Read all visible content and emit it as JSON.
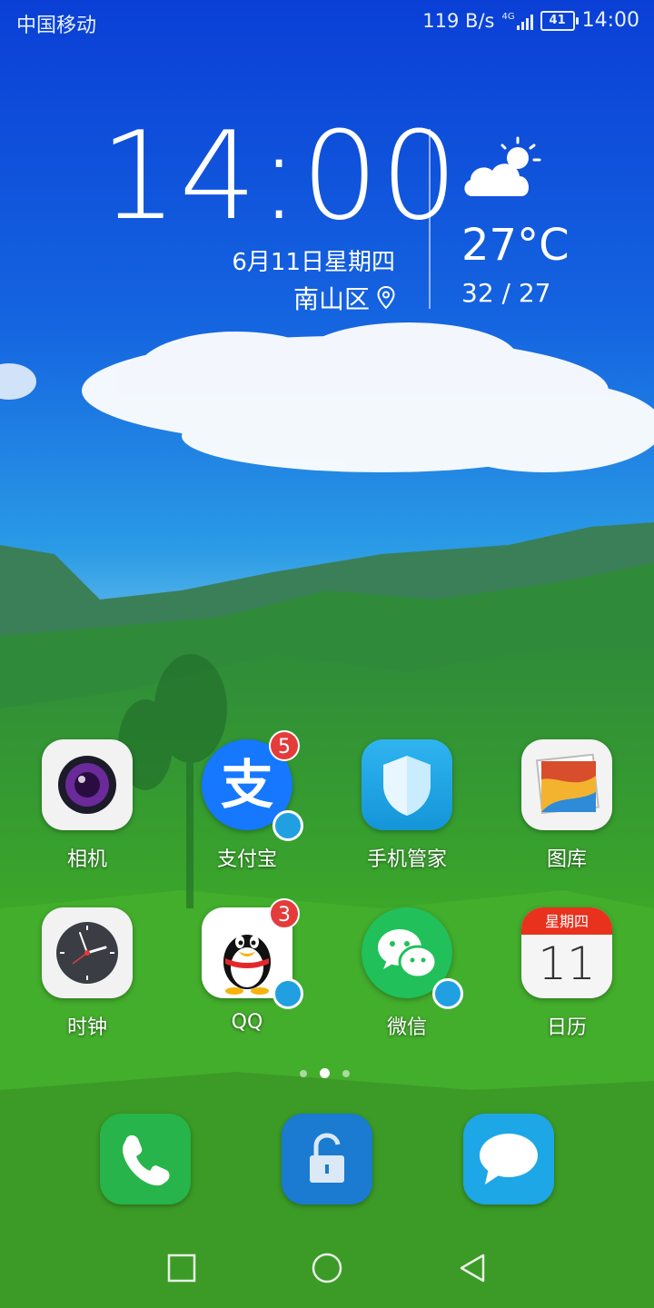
{
  "status_bar": {
    "carrier": "中国移动",
    "net_speed": "119 B/s",
    "network_type": "4G",
    "battery": "41",
    "time": "14:00"
  },
  "clock_widget": {
    "time": "14:00",
    "date": "6月11日星期四",
    "location": "南山区",
    "weather_icon": "partly-cloudy-icon",
    "temperature": "27°C",
    "range": "32 / 27"
  },
  "apps": [
    {
      "label": "相机",
      "icon": "camera-icon"
    },
    {
      "label": "支付宝",
      "icon": "alipay-icon",
      "badge": "5"
    },
    {
      "label": "手机管家",
      "icon": "phone-manager-icon"
    },
    {
      "label": "图库",
      "icon": "gallery-icon"
    },
    {
      "label": "时钟",
      "icon": "clock-icon"
    },
    {
      "label": "QQ",
      "icon": "qq-icon",
      "badge": "3"
    },
    {
      "label": "微信",
      "icon": "wechat-icon"
    },
    {
      "label": "日历",
      "icon": "calendar-icon",
      "calendar_header": "星期四",
      "calendar_day": "11"
    }
  ],
  "dock": [
    {
      "icon": "phone-icon"
    },
    {
      "icon": "lock-icon"
    },
    {
      "icon": "messages-icon"
    }
  ],
  "navigation": {
    "recent": "square-icon",
    "home": "circle-icon",
    "back": "triangle-icon"
  },
  "colors": {
    "sky_top": "#0a3fd6",
    "sky_mid": "#1e88e5",
    "grass": "#3aa62a",
    "badge": "#e43b3b",
    "verified": "#20a0e0"
  }
}
